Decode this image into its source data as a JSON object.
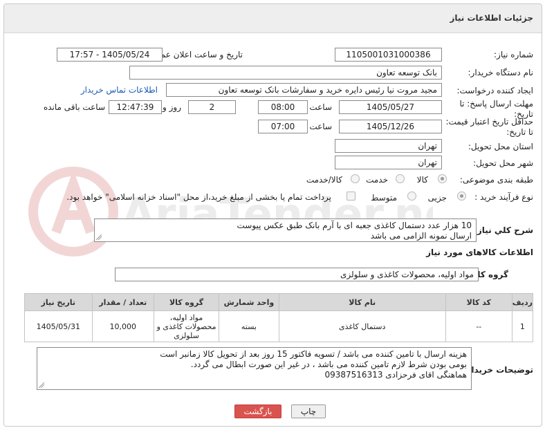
{
  "panel": {
    "title": "جزئیات اطلاعات نیاز"
  },
  "fields": {
    "need_number": {
      "label": "شماره نیاز:",
      "value": "1105001031000386"
    },
    "announce_datetime": {
      "label": "تاریخ و ساعت اعلان عمومی:",
      "value": "1405/05/24 - 17:57"
    },
    "buyer_org": {
      "label": "نام دستگاه خریدار:",
      "value": "بانک توسعه تعاون"
    },
    "requester": {
      "label": "ایجاد کننده درخواست:",
      "value": "مجید مروت نیا رئیس دایره خرید و سفارشات بانک توسعه تعاون",
      "contact_link": "اطلاعات تماس خریدار"
    },
    "reply_deadline": {
      "label_line1": "مهلت ارسال پاسخ: تا",
      "label_line2": "تاریخ:",
      "date": "1405/05/27",
      "time_label": "ساعت",
      "time": "08:00",
      "days": "2",
      "days_label": "روز و",
      "remaining": "12:47:39",
      "remaining_label": "ساعت باقی مانده"
    },
    "price_validity": {
      "label_line1": "حداقل تاریخ اعتبار قیمت:",
      "label_line2": "تا تاریخ:",
      "date": "1405/12/26",
      "time_label": "ساعت",
      "time": "07:00"
    },
    "delivery_province": {
      "label": "استان محل تحویل:",
      "value": "تهران"
    },
    "delivery_city": {
      "label": "شهر محل تحویل:",
      "value": "تهران"
    },
    "category": {
      "label": "طبقه بندی موضوعی:",
      "options": [
        "کالا",
        "خدمت",
        "کالا/خدمت"
      ],
      "selected": "کالا"
    },
    "purchase_process": {
      "label": "نوع فرآیند خرید :",
      "options": [
        "جزیی",
        "متوسط"
      ],
      "selected": "جزیی",
      "treasury_note": "پرداخت تمام یا بخشی از مبلغ خرید،از محل \"اسناد خزانه اسلامی\" خواهد بود."
    }
  },
  "description": {
    "label": "شرح کلي نياز:",
    "line1": "10 هزار عدد دستمال کاغذی جعبه ای با آرم بانک طبق عکس پیوست",
    "line2": "ارسال نمونه الزامی می باشد"
  },
  "goods_section": {
    "title": "اطلاعات کالاهای مورد نیاز"
  },
  "goods_group": {
    "label": "گروه کالا:",
    "value": "مواد اولیه، محصولات کاغذی و سلولزی"
  },
  "table": {
    "headers": [
      "ردیف",
      "کد کالا",
      "نام کالا",
      "واحد شمارش",
      "گروه کالا",
      "تعداد / مقدار",
      "تاریخ نیاز"
    ],
    "rows": [
      {
        "row": "1",
        "code": "--",
        "name": "دستمال کاغذی",
        "unit": "بسته",
        "group_line1": "مواد اولیه،",
        "group_line2": "محصولات کاغذی و",
        "group_line3": "سلولزی",
        "qty": "10,000",
        "date": "1405/05/31"
      }
    ]
  },
  "buyer_notes": {
    "label": "توضیحات خریدار:",
    "line1": "هزینه ارسال با تامین کننده می باشد / تسویه فاکتور 15 روز بعد از تحویل کالا زمانبر است",
    "line2": "بومی بودن شرط لازم تامین کننده می باشد ، در غیر این صورت ابطال می گردد.",
    "line3": "هماهنگی اقای فرحزادی 09387516313"
  },
  "buttons": {
    "print": "چاپ",
    "back": "بازگشت"
  },
  "watermark": {
    "text": "AriaTender.neT"
  }
}
